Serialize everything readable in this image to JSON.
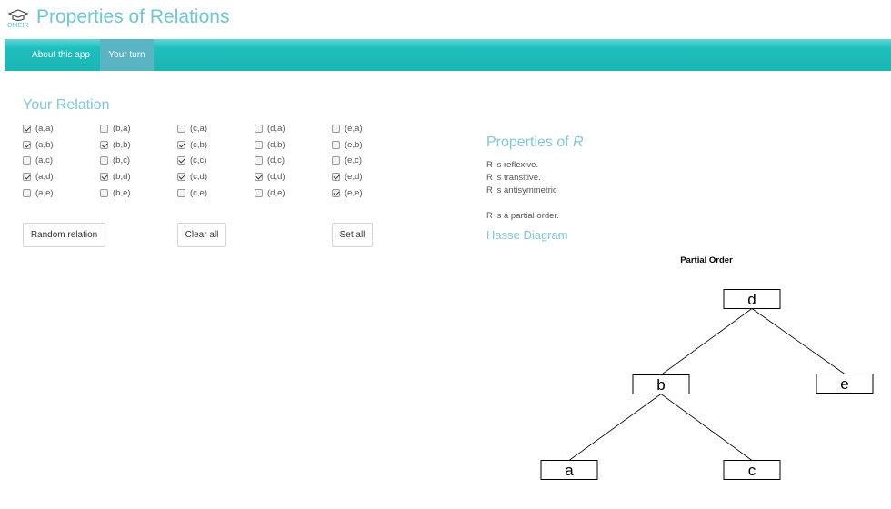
{
  "header": {
    "logo_text": "OMEIR",
    "logo_icon": "mortarboard-icon",
    "title": "Properties of Relations"
  },
  "nav": {
    "tabs": [
      {
        "label": "About this app",
        "active": false
      },
      {
        "label": "Your turn",
        "active": true
      }
    ]
  },
  "relation": {
    "title": "Your Relation",
    "pairs": [
      {
        "label": "(a,a)",
        "checked": true
      },
      {
        "label": "(a,b)",
        "checked": true
      },
      {
        "label": "(a,c)",
        "checked": false
      },
      {
        "label": "(a,d)",
        "checked": true
      },
      {
        "label": "(a,e)",
        "checked": false
      },
      {
        "label": "(b,a)",
        "checked": false
      },
      {
        "label": "(b,b)",
        "checked": true
      },
      {
        "label": "(b,c)",
        "checked": false
      },
      {
        "label": "(b,d)",
        "checked": true
      },
      {
        "label": "(b,e)",
        "checked": false
      },
      {
        "label": "(c,a)",
        "checked": false
      },
      {
        "label": "(c,b)",
        "checked": true
      },
      {
        "label": "(c,c)",
        "checked": true
      },
      {
        "label": "(c,d)",
        "checked": true
      },
      {
        "label": "(c,e)",
        "checked": false
      },
      {
        "label": "(d,a)",
        "checked": false
      },
      {
        "label": "(d,b)",
        "checked": false
      },
      {
        "label": "(d,c)",
        "checked": false
      },
      {
        "label": "(d,d)",
        "checked": true
      },
      {
        "label": "(d,e)",
        "checked": false
      },
      {
        "label": "(e,a)",
        "checked": false
      },
      {
        "label": "(e,b)",
        "checked": false
      },
      {
        "label": "(e,c)",
        "checked": false
      },
      {
        "label": "(e,d)",
        "checked": true
      },
      {
        "label": "(e,e)",
        "checked": true
      }
    ],
    "buttons": {
      "random": "Random relation",
      "clear": "Clear all",
      "set": "Set all"
    }
  },
  "properties": {
    "title_prefix": "Properties of ",
    "title_var": "R",
    "lines": [
      "R is reflexive.",
      "R is transitive.",
      "R is antisymmetric"
    ],
    "conclusion": "R is a partial order."
  },
  "hasse": {
    "section_title": "Hasse Diagram",
    "plot_title": "Partial Order",
    "nodes": [
      {
        "id": "d",
        "label": "d"
      },
      {
        "id": "b",
        "label": "b"
      },
      {
        "id": "e",
        "label": "e"
      },
      {
        "id": "a",
        "label": "a"
      },
      {
        "id": "c",
        "label": "c"
      }
    ],
    "edges": [
      [
        "d",
        "b"
      ],
      [
        "d",
        "e"
      ],
      [
        "b",
        "a"
      ],
      [
        "b",
        "c"
      ]
    ]
  }
}
